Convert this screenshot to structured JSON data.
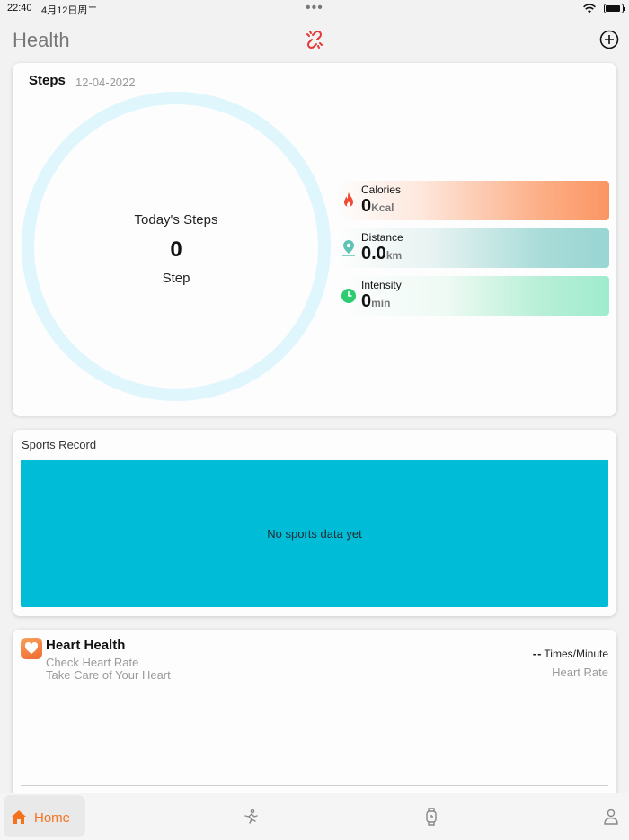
{
  "status_bar": {
    "time": "22:40",
    "date": "4月12日周二",
    "dots": "•••"
  },
  "header": {
    "title": "Health",
    "icons": [
      "link-broken-icon",
      "plus-circle-icon"
    ]
  },
  "steps_card": {
    "title": "Steps",
    "date": "12-04-2022",
    "center_label": "Today's Steps",
    "center_value": "0",
    "center_unit": "Step",
    "metrics": [
      {
        "label": "Calories",
        "value": "0",
        "unit": "Kcal",
        "icon": "flame-icon",
        "color": "#ef5a3c"
      },
      {
        "label": "Distance",
        "value": "0.0",
        "unit": "km",
        "icon": "location-pin-icon",
        "color": "#5fc3b6"
      },
      {
        "label": "Intensity",
        "value": "0",
        "unit": "min",
        "icon": "clock-icon",
        "color": "#2ecc71"
      }
    ]
  },
  "sports_record": {
    "title": "Sports Record",
    "empty_message": "No sports data yet",
    "panel_color": "#00bcd6"
  },
  "heart_health": {
    "title": "Heart Health",
    "subtitle_1": "Check Heart Rate",
    "subtitle_2": "Take Care of Your Heart",
    "value": "--",
    "unit": "Times/Minute",
    "caption": "Heart Rate"
  },
  "tab_bar": {
    "active_color": "#f4721e",
    "tabs": [
      {
        "label": "Home",
        "icon": "home-icon",
        "active": true
      },
      {
        "label": "",
        "icon": "sport-icon",
        "active": false
      },
      {
        "label": "",
        "icon": "watch-icon",
        "active": false
      },
      {
        "label": "",
        "icon": "profile-icon",
        "active": false
      }
    ]
  }
}
